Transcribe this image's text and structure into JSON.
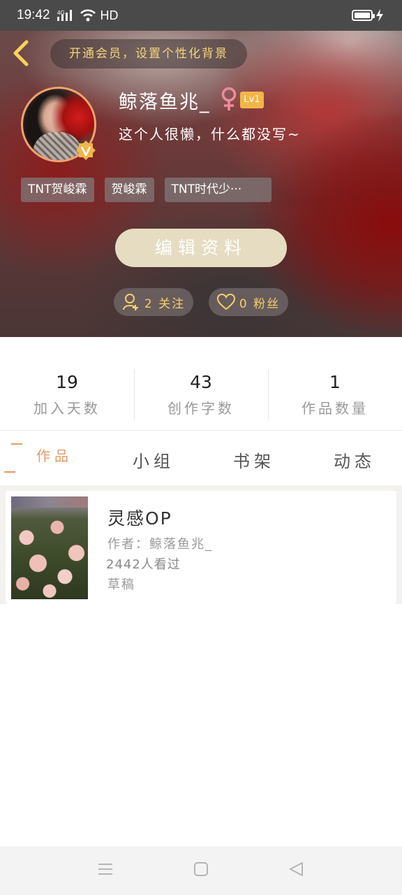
{
  "status_bar": {
    "time": "19:42",
    "network": "4G",
    "hd": "HD"
  },
  "header": {
    "vip_text": "开通会员，设置个性化背景"
  },
  "profile": {
    "username": "鲸落鱼兆_",
    "level": "Lv1",
    "bio": "这个人很懒，什么都没写~",
    "tags": [
      "TNT贺峻霖",
      "贺峻霖",
      "TNT时代少···"
    ],
    "edit_button": "编辑资料",
    "following": "2 关注",
    "followers": "0 粉丝"
  },
  "stats": [
    {
      "value": "19",
      "label": "加入天数"
    },
    {
      "value": "43",
      "label": "创作字数"
    },
    {
      "value": "1",
      "label": "作品数量"
    }
  ],
  "tabs": {
    "works": "作品",
    "group": "小组",
    "bookshelf": "书架",
    "feed": "动态"
  },
  "works": [
    {
      "title": "灵感OP",
      "author": "作者：鲸落鱼兆_",
      "views": "2442人看过",
      "status": "草稿"
    }
  ],
  "colors": {
    "accent": "#f4b547",
    "tab_active": "#e49a6a",
    "edit_button_bg": "#e6dcc2"
  },
  "icons": [
    "back-icon",
    "female-icon",
    "verified-icon",
    "add-user-icon",
    "heart-icon",
    "menu-icon",
    "home-icon",
    "back-triangle-icon"
  ]
}
